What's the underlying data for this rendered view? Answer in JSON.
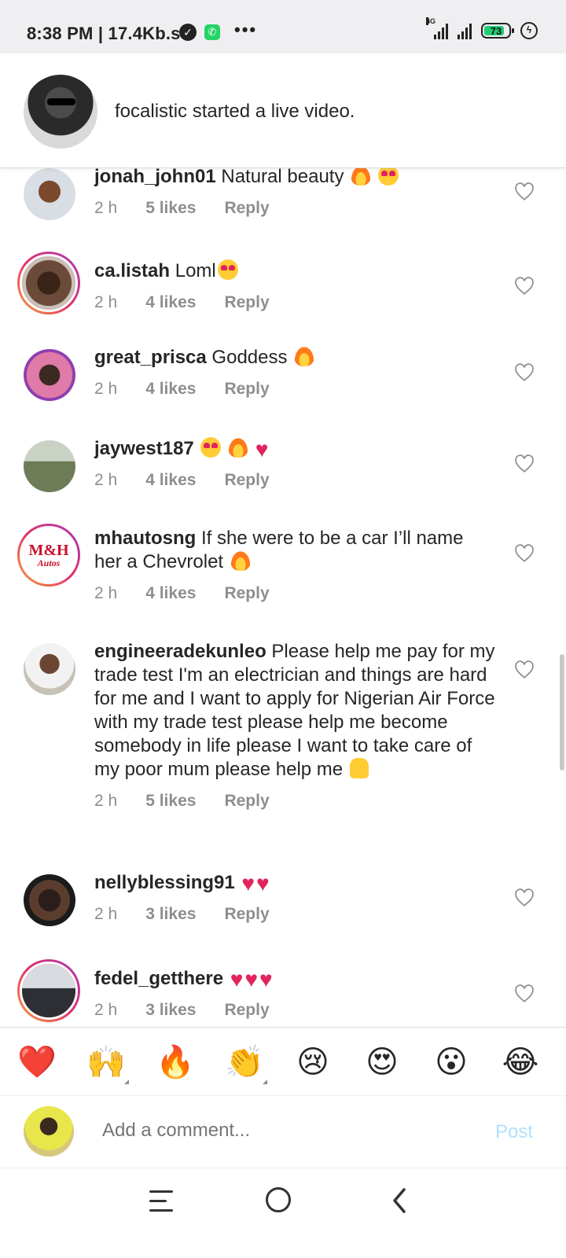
{
  "status_bar": {
    "time_speed": "8:38 PM | 17.4Kb.s",
    "network": "4G",
    "battery": "73"
  },
  "live_banner": {
    "text": "focalistic started a live video."
  },
  "comments": [
    {
      "username": "jonah_john01",
      "text": "Natural beauty",
      "time": "2 h",
      "likes": "5 likes",
      "reply": "Reply"
    },
    {
      "username": "ca.listah",
      "text": "Loml",
      "time": "2 h",
      "likes": "4 likes",
      "reply": "Reply"
    },
    {
      "username": "great_prisca",
      "text": "Goddess",
      "time": "2 h",
      "likes": "4 likes",
      "reply": "Reply"
    },
    {
      "username": "jaywest187",
      "text": "",
      "time": "2 h",
      "likes": "4 likes",
      "reply": "Reply"
    },
    {
      "username": "mhautosng",
      "text": "If she were to be a car I’ll name her a Chevrolet",
      "time": "2 h",
      "likes": "4 likes",
      "reply": "Reply",
      "avatar_text": "M&H",
      "avatar_sub": "Autos"
    },
    {
      "username": "engineeradekunleo",
      "text": "Please help me pay for my trade test I'm an electrician and things are hard for me and I want to apply for Nigerian Air Force with my trade test please help me become somebody in life please I want to take care of my poor mum please help me",
      "time": "2 h",
      "likes": "5 likes",
      "reply": "Reply"
    },
    {
      "username": "nellyblessing91",
      "text": "",
      "time": "2 h",
      "likes": "3 likes",
      "reply": "Reply"
    },
    {
      "username": "fedel_getthere",
      "text": "",
      "time": "2 h",
      "likes": "3 likes",
      "reply": "Reply"
    }
  ],
  "reactions": [
    "❤️",
    "🙌",
    "🔥",
    "👏",
    "😢",
    "😍",
    "😮",
    "😂"
  ],
  "comment_bar": {
    "placeholder": "Add a comment...",
    "post_label": "Post"
  },
  "colors": {
    "accent_link": "#b2dffc",
    "meta_gray": "#8e8e8e",
    "story_ring": "#e1306c"
  }
}
